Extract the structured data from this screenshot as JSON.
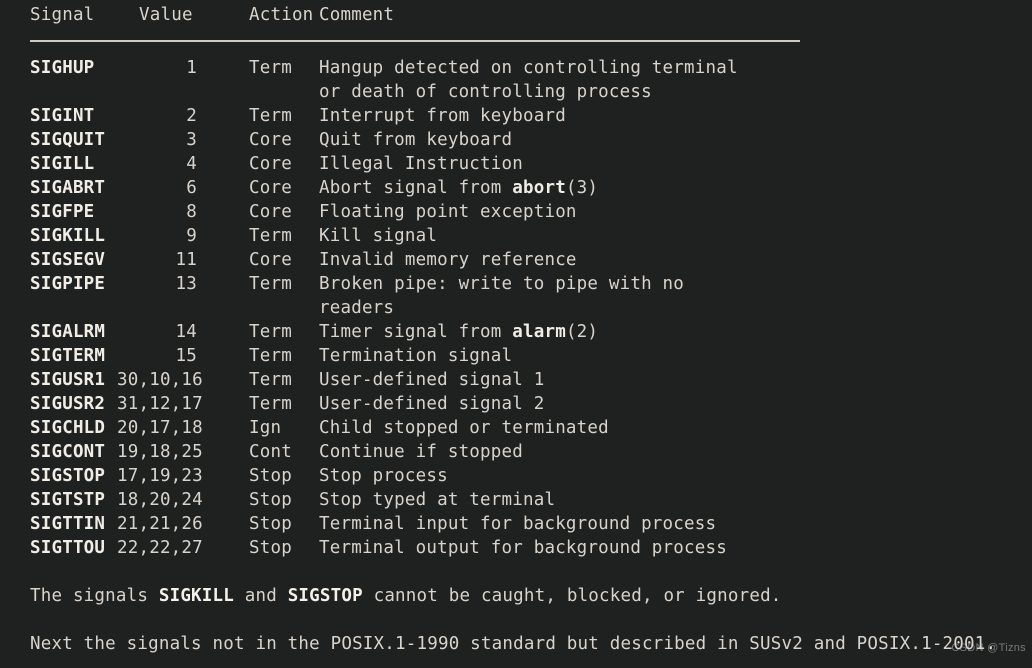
{
  "background_color": "#1f2020",
  "text_color": "#d8d4cd",
  "bold_text_color": "#f0ece6",
  "table": {
    "headers": {
      "signal": "Signal",
      "value": "Value",
      "action": "Action",
      "comment": "Comment"
    },
    "rows": [
      {
        "signal": "SIGHUP",
        "value": "1",
        "action": "Term",
        "comment": "Hangup detected on controlling terminal",
        "comment_cont": "or death of controlling process"
      },
      {
        "signal": "SIGINT",
        "value": "2",
        "action": "Term",
        "comment": "Interrupt from keyboard"
      },
      {
        "signal": "SIGQUIT",
        "value": "3",
        "action": "Core",
        "comment": "Quit from keyboard"
      },
      {
        "signal": "SIGILL",
        "value": "4",
        "action": "Core",
        "comment": "Illegal Instruction"
      },
      {
        "signal": "SIGABRT",
        "value": "6",
        "action": "Core",
        "comment_html": "Abort signal from <b>abort</b>(3)"
      },
      {
        "signal": "SIGFPE",
        "value": "8",
        "action": "Core",
        "comment": "Floating point exception"
      },
      {
        "signal": "SIGKILL",
        "value": "9",
        "action": "Term",
        "comment": "Kill signal"
      },
      {
        "signal": "SIGSEGV",
        "value": "11",
        "action": "Core",
        "comment": "Invalid memory reference"
      },
      {
        "signal": "SIGPIPE",
        "value": "13",
        "action": "Term",
        "comment": "Broken pipe: write to pipe with no",
        "comment_cont": "readers"
      },
      {
        "signal": "SIGALRM",
        "value": "14",
        "action": "Term",
        "comment_html": "Timer signal from <b>alarm</b>(2)"
      },
      {
        "signal": "SIGTERM",
        "value": "15",
        "action": "Term",
        "comment": "Termination signal"
      },
      {
        "signal": "SIGUSR1",
        "value": "30,10,16",
        "action": "Term",
        "comment": "User-defined signal 1"
      },
      {
        "signal": "SIGUSR2",
        "value": "31,12,17",
        "action": "Term",
        "comment": "User-defined signal 2"
      },
      {
        "signal": "SIGCHLD",
        "value": "20,17,18",
        "action": "Ign",
        "comment": "Child stopped or terminated"
      },
      {
        "signal": "SIGCONT",
        "value": "19,18,25",
        "action": "Cont",
        "comment": "Continue if stopped"
      },
      {
        "signal": "SIGSTOP",
        "value": "17,19,23",
        "action": "Stop",
        "comment": "Stop process"
      },
      {
        "signal": "SIGTSTP",
        "value": "18,20,24",
        "action": "Stop",
        "comment": "Stop typed at terminal"
      },
      {
        "signal": "SIGTTIN",
        "value": "21,21,26",
        "action": "Stop",
        "comment": "Terminal input for background process"
      },
      {
        "signal": "SIGTTOU",
        "value": "22,22,27",
        "action": "Stop",
        "comment": "Terminal output for background process"
      }
    ]
  },
  "footer": {
    "line1_html": "The signals <b>SIGKILL</b> and <b>SIGSTOP</b> cannot be caught, blocked, or ignored.",
    "line2": "Next the signals not in the POSIX.1-1990 standard but described in SUSv2 and POSIX.1-2001."
  },
  "watermark": {
    "text": "CSDN @Tizns"
  }
}
